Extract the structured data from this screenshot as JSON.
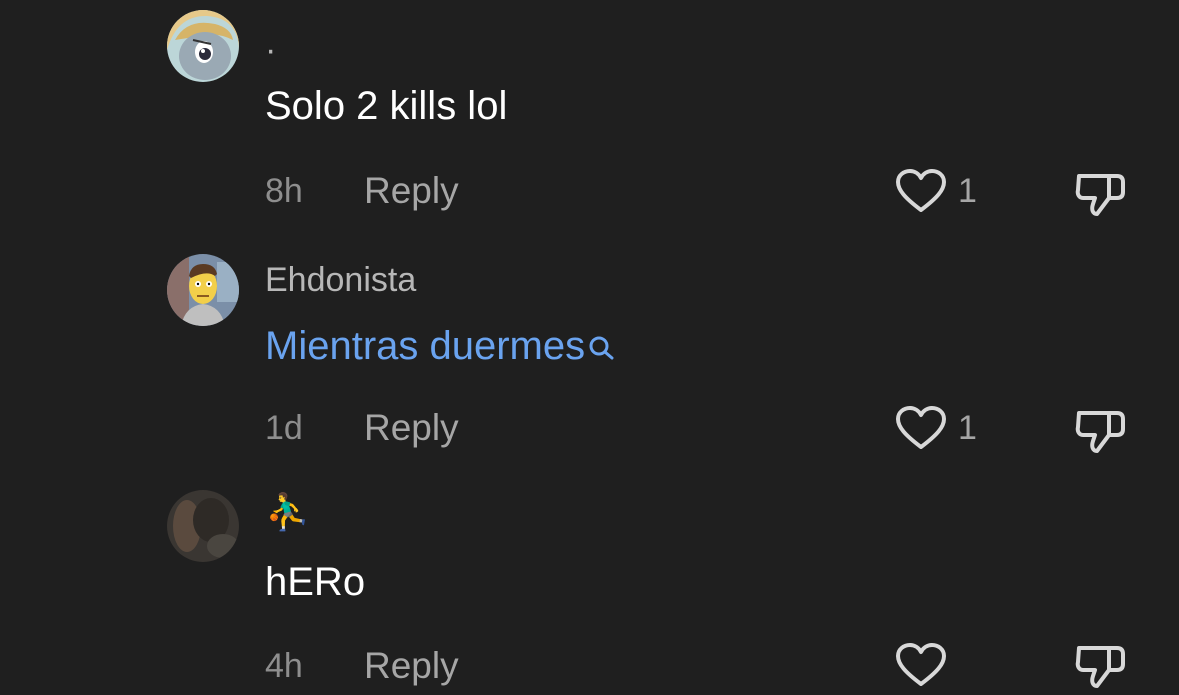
{
  "comments": [
    {
      "username": "·",
      "text": "Solo 2 kills lol",
      "time": "8h",
      "reply_label": "Reply",
      "like_count": "1",
      "avatar_icon": "pony-avatar-icon"
    },
    {
      "username": "Ehdonista",
      "text": "Mientras duermes",
      "text_is_search_link": true,
      "time": "1d",
      "reply_label": "Reply",
      "like_count": "1",
      "avatar_icon": "cartoon-man-avatar-icon"
    },
    {
      "username": "⛹️‍♂️",
      "text": "hERo",
      "time": "4h",
      "reply_label": "Reply",
      "like_count": "",
      "avatar_icon": "dark-photo-avatar-icon"
    }
  ],
  "colors": {
    "background": "#1f1f1f",
    "link": "#6aa3ef",
    "secondary_text": "#a6a6a6"
  }
}
